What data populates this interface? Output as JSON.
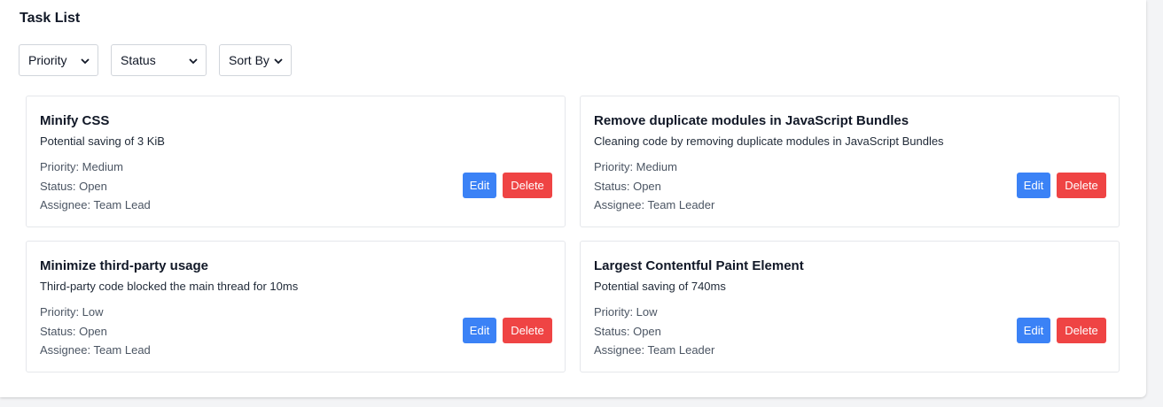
{
  "page": {
    "title": "Task List"
  },
  "filters": {
    "priority": "Priority",
    "status": "Status",
    "sort": "Sort By"
  },
  "tasks": [
    {
      "title": "Minify CSS",
      "description": "Potential saving of 3 KiB",
      "priority": "Priority: Medium",
      "status": "Status: Open",
      "assignee": "Assignee: Team Lead",
      "edit_label": "Edit",
      "delete_label": "Delete"
    },
    {
      "title": "Remove duplicate modules in JavaScript Bundles",
      "description": "Cleaning code by removing duplicate modules in JavaScript Bundles",
      "priority": "Priority: Medium",
      "status": "Status: Open",
      "assignee": "Assignee: Team Leader",
      "edit_label": "Edit",
      "delete_label": "Delete"
    },
    {
      "title": "Minimize third-party usage",
      "description": "Third-party code blocked the main thread for 10ms",
      "priority": "Priority: Low",
      "status": "Status: Open",
      "assignee": "Assignee: Team Lead",
      "edit_label": "Edit",
      "delete_label": "Delete"
    },
    {
      "title": "Largest Contentful Paint Element",
      "description": "Potential saving of 740ms",
      "priority": "Priority: Low",
      "status": "Status: Open",
      "assignee": "Assignee: Team Leader",
      "edit_label": "Edit",
      "delete_label": "Delete"
    }
  ],
  "icons": {
    "dropdown": "chevron-down-icon"
  },
  "colors": {
    "edit_button": "#3b82f6",
    "delete_button": "#ef4444",
    "panel_background": "#ffffff",
    "page_background": "#f3f4f6"
  }
}
